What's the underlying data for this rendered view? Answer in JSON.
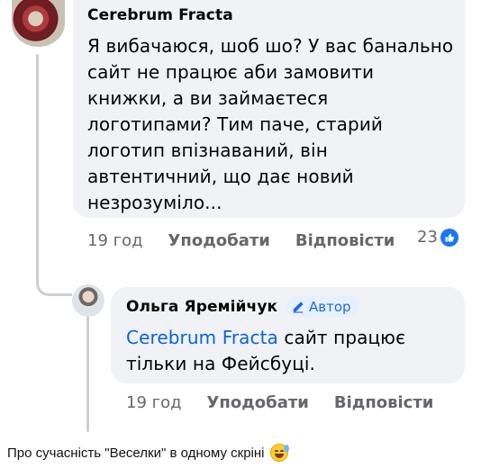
{
  "comment": {
    "author": "Cerebrum Fracta",
    "text": "Я вибачаюся, шоб шо? У вас банально сайт не працює аби замовити книжки, а ви займаєтеся логотипами? Тим паче, старий логотип впізнаваний, він автентичний, що дає новий незрозуміло...",
    "time": "19 год",
    "like_label": "Уподобати",
    "reply_label": "Відповісти",
    "reaction_count": "23",
    "reaction_icon": "like-icon",
    "accent_color": "#1877f2"
  },
  "reply": {
    "author": "Ольга Яремійчук",
    "badge_label": "Автор",
    "badge_icon": "pencil-icon",
    "mention": "Cerebrum Fracta",
    "text": " сайт працює тільки на Фейсбуці.",
    "time": "19 год",
    "like_label": "Уподобати",
    "reply_label": "Відповісти",
    "mention_color": "#0a64d8"
  },
  "caption": {
    "text": "Про сучасність \"Веселки\" в одному скріні",
    "emoji": "grinning-sweat-emoji"
  }
}
